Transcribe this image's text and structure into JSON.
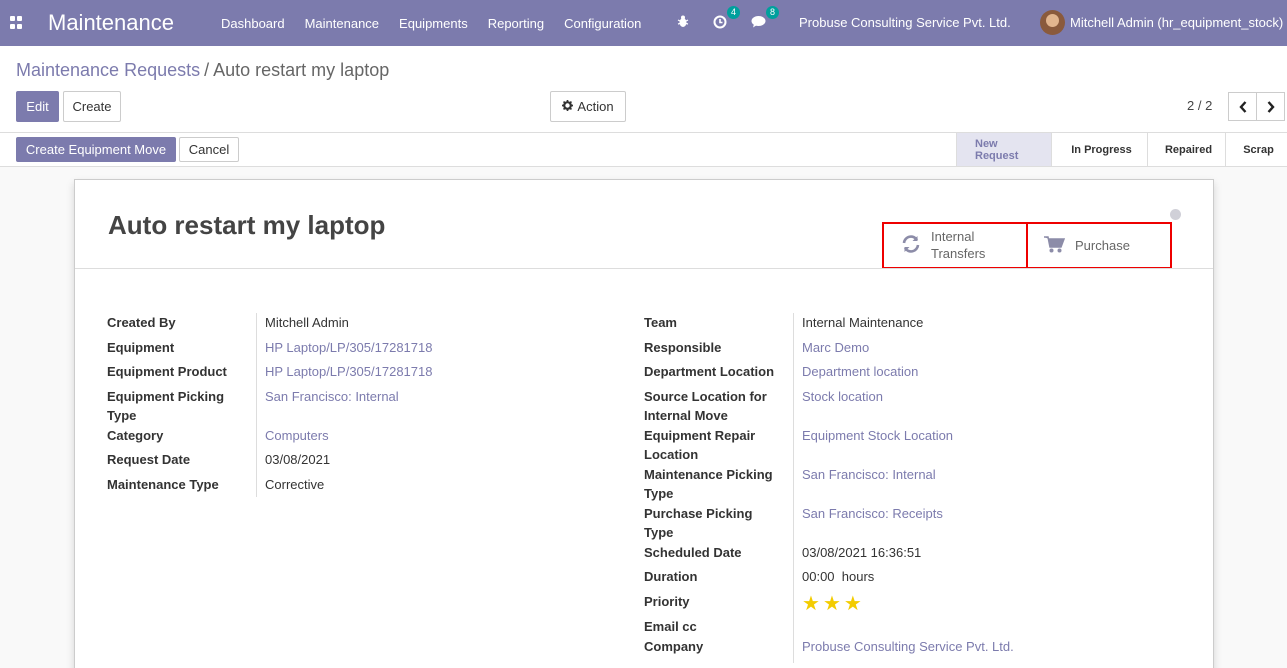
{
  "app": {
    "title": "Maintenance"
  },
  "menu": [
    "Dashboard",
    "Maintenance",
    "Equipments",
    "Reporting",
    "Configuration"
  ],
  "systray": {
    "activity_count": "4",
    "message_count": "8",
    "company": "Probuse Consulting Service Pvt. Ltd.",
    "user": "Mitchell Admin (hr_equipment_stock)"
  },
  "breadcrumb": {
    "parent": "Maintenance Requests",
    "current": "Auto restart my laptop"
  },
  "buttons": {
    "edit": "Edit",
    "create": "Create",
    "action": "Action",
    "create_move": "Create Equipment Move",
    "cancel": "Cancel"
  },
  "pager": {
    "value": "2 / 2"
  },
  "stages": [
    "New Request",
    "In Progress",
    "Repaired",
    "Scrap"
  ],
  "record": {
    "title": "Auto restart my laptop",
    "smart_buttons": {
      "internal_transfers_1": "Internal",
      "internal_transfers_2": "Transfers",
      "purchase": "Purchase"
    },
    "left": {
      "created_by_label": "Created By",
      "created_by": "Mitchell Admin",
      "equipment_label": "Equipment",
      "equipment": "HP Laptop/LP/305/17281718",
      "equipment_product_label": "Equipment Product",
      "equipment_product": "HP Laptop/LP/305/17281718",
      "picking_type_label_1": "Equipment Picking",
      "picking_type_label_2": "Type",
      "picking_type": "San Francisco: Internal",
      "category_label": "Category",
      "category": "Computers",
      "request_date_label": "Request Date",
      "request_date": "03/08/2021",
      "maintenance_type_label": "Maintenance Type",
      "maintenance_type": "Corrective"
    },
    "right": {
      "team_label": "Team",
      "team": "Internal Maintenance",
      "responsible_label": "Responsible",
      "responsible": "Marc Demo",
      "dept_location_label": "Department Location",
      "dept_location": "Department location",
      "source_location_label_1": "Source Location for",
      "source_location_label_2": "Internal Move",
      "source_location": "Stock location",
      "repair_location_label_1": "Equipment Repair",
      "repair_location_label_2": "Location",
      "repair_location": "Equipment Stock Location",
      "maint_picking_label_1": "Maintenance Picking",
      "maint_picking_label_2": "Type",
      "maint_picking": "San Francisco: Internal",
      "purchase_picking_label_1": "Purchase Picking",
      "purchase_picking_label_2": "Type",
      "purchase_picking": "San Francisco: Receipts",
      "scheduled_date_label": "Scheduled Date",
      "scheduled_date": "03/08/2021 16:36:51",
      "duration_label": "Duration",
      "duration": "00:00  hours",
      "priority_label": "Priority",
      "priority_stars": 3,
      "email_cc_label": "Email cc",
      "email_cc": "",
      "company_label": "Company",
      "company": "Probuse Consulting Service Pvt. Ltd."
    }
  },
  "colors": {
    "brand": "#7c7bad",
    "highlight_box": "#e00000",
    "star": "#f3cc00"
  }
}
